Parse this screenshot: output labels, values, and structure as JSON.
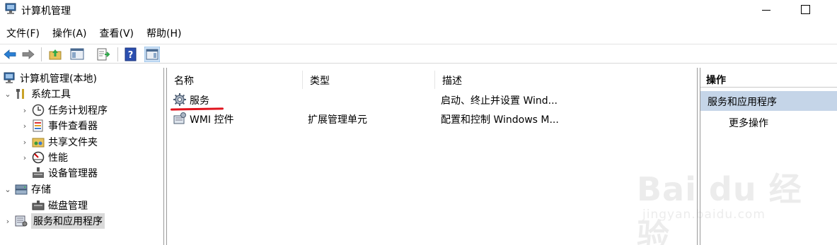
{
  "window": {
    "title": "计算机管理"
  },
  "menu": [
    {
      "label": "文件(F)"
    },
    {
      "label": "操作(A)"
    },
    {
      "label": "查看(V)"
    },
    {
      "label": "帮助(H)"
    }
  ],
  "toolbar": {
    "buttons": [
      "back-arrow-icon",
      "forward-arrow-icon",
      "up-folder-icon",
      "show-hide-console-tree-icon",
      "export-list-icon",
      "help-icon",
      "show-hide-action-pane-icon"
    ]
  },
  "tree": {
    "root": "计算机管理(本地)",
    "system_tools": "系统工具",
    "task_scheduler": "任务计划程序",
    "event_viewer": "事件查看器",
    "shared_folders": "共享文件夹",
    "performance": "性能",
    "device_manager": "设备管理器",
    "storage": "存储",
    "disk_management": "磁盘管理",
    "services_apps": "服务和应用程序",
    "expand_open": "⌄",
    "expand_closed": "›"
  },
  "list": {
    "columns": [
      "名称",
      "类型",
      "描述"
    ],
    "rows": [
      {
        "name": "服务",
        "type": "",
        "desc": "启动、终止并设置 Wind..."
      },
      {
        "name": "WMI 控件",
        "type": "扩展管理单元",
        "desc": "配置和控制 Windows M..."
      }
    ]
  },
  "actions": {
    "header": "操作",
    "section": "服务和应用程序",
    "more": "更多操作"
  },
  "watermark": {
    "brand": "Bai du 经验",
    "url": "jingyan.baidu.com"
  },
  "colors": {
    "selection": "#c5d5e8",
    "annotation_red": "#e0141e"
  }
}
